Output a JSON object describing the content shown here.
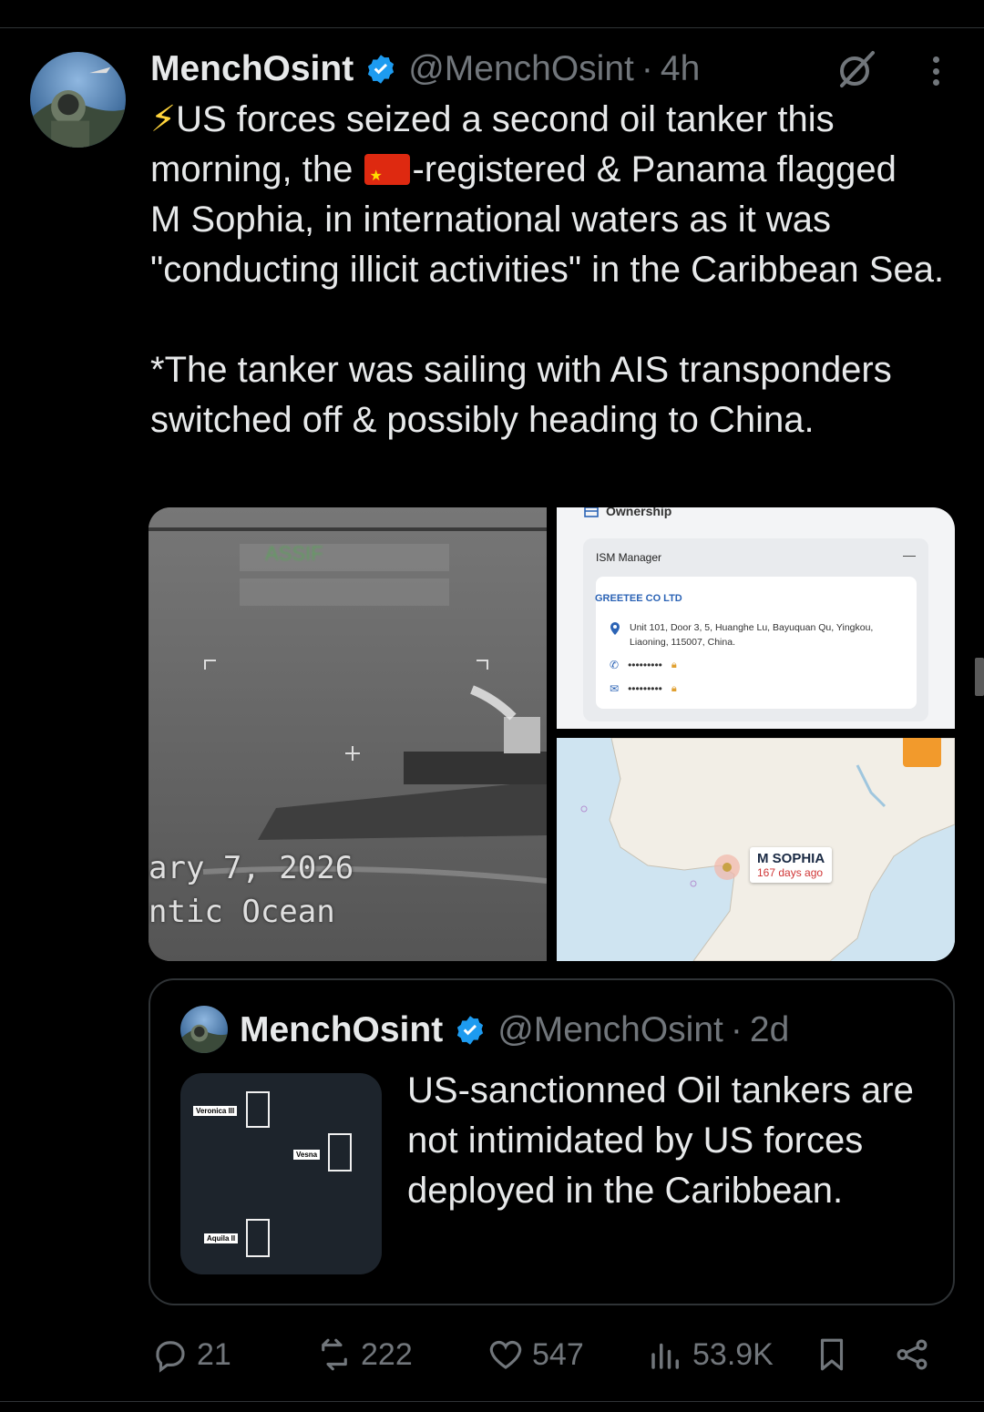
{
  "tweet": {
    "author_name": "MenchOsint",
    "handle": "@MenchOsint",
    "separator": "·",
    "time": "4h",
    "text_line1_a": "⚡",
    "text_line1_b": "US forces seized a second oil tanker this",
    "text_line2_a": "morning, the ",
    "text_line2_b": "-registered & Panama flagged",
    "text_rest": "M Sophia, in international waters as it was \"conducting illicit activities\" in the Caribbean Sea.",
    "text_para2": "*The tanker was sailing with AIS transponders switched off & possibly heading to China.",
    "flag_icon": "china-flag-emoji"
  },
  "media": {
    "flir": {
      "date_overlay": "ary 7, 2026",
      "location_overlay": "ntic Ocean",
      "classification": "ASSIF"
    },
    "ownership": {
      "section_title": "Ownership",
      "card_label": "ISM Manager",
      "collapse_symbol": "—",
      "company": "GREETEE CO LTD",
      "address": "Unit 101, Door 3, 5, Huanghe Lu, Bayuquan Qu, Yingkou, Liaoning, 115007, China.",
      "phone_masked": "•••••••••",
      "email_masked": "•••••••••"
    },
    "map": {
      "ship_name": "M SOPHIA",
      "ship_age": "167 days ago"
    }
  },
  "quote": {
    "author_name": "MenchOsint",
    "handle": "@MenchOsint",
    "separator": "·",
    "time": "2d",
    "text": "US-sanctionned Oil tankers are not intimidated by US forces deployed in the Caribbean.",
    "image_labels": [
      "Veronica III",
      "Vesna",
      "Aquila II"
    ]
  },
  "actions": {
    "replies": "21",
    "reposts": "222",
    "likes": "547",
    "views": "53.9K"
  },
  "colors": {
    "background": "#000000",
    "text": "#e7e9ea",
    "muted": "#71767b",
    "border": "#2f3336",
    "verified": "#1d9bf0"
  }
}
